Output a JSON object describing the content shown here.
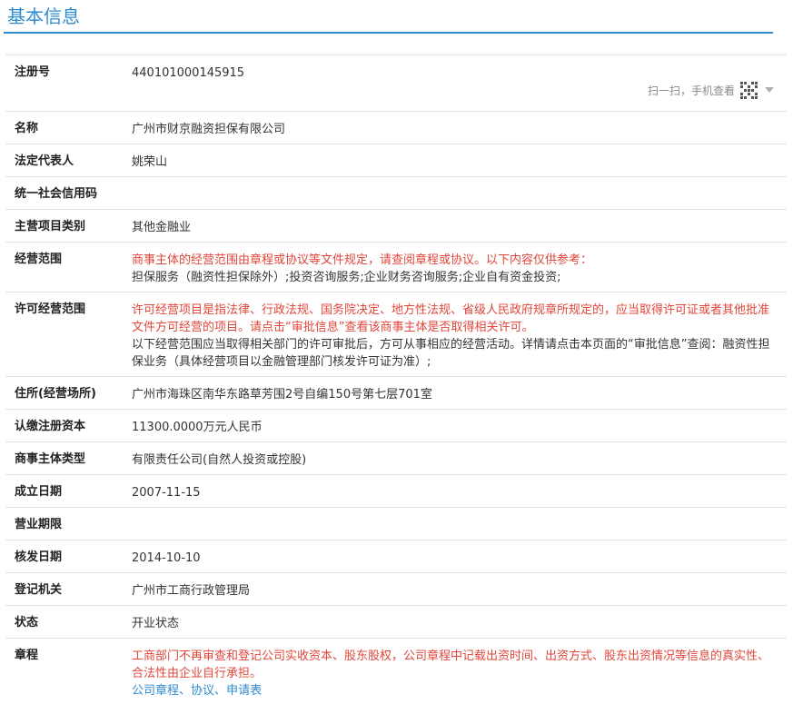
{
  "header": {
    "title": "基本信息"
  },
  "scan": {
    "text": "扫一扫，手机查看"
  },
  "rows": [
    {
      "label": "注册号",
      "value": "440101000145915"
    },
    {
      "label": "名称",
      "value": "广州市财京融资担保有限公司"
    },
    {
      "label": "法定代表人",
      "value": "姚荣山"
    },
    {
      "label": "统一社会信用码",
      "value": ""
    },
    {
      "label": "主营项目类别",
      "value": "其他金融业"
    },
    {
      "label": "经营范围",
      "notice": "商事主体的经营范围由章程或协议等文件规定，请查阅章程或协议。以下内容仅供参考：",
      "value": "担保服务（融资性担保除外）;投资咨询服务;企业财务咨询服务;企业自有资金投资;"
    },
    {
      "label": "许可经营范围",
      "notice": "许可经营项目是指法律、行政法规、国务院决定、地方性法规、省级人民政府规章所规定的，应当取得许可证或者其他批准文件方可经营的项目。请点击“审批信息”查看该商事主体是否取得相关许可。",
      "value": "以下经营范围应当取得相关部门的许可审批后，方可从事相应的经营活动。详情请点击本页面的“审批信息”查阅：融资性担保业务（具体经营项目以金融管理部门核发许可证为准）;"
    },
    {
      "label": "住所(经营场所)",
      "value": "广州市海珠区南华东路草芳围2号自编150号第七层701室"
    },
    {
      "label": "认缴注册资本",
      "value": "11300.0000万元人民币"
    },
    {
      "label": "商事主体类型",
      "value": "有限责任公司(自然人投资或控股)"
    },
    {
      "label": "成立日期",
      "value": "2007-11-15"
    },
    {
      "label": "营业期限",
      "value": ""
    },
    {
      "label": "核发日期",
      "value": "2014-10-10"
    },
    {
      "label": "登记机关",
      "value": "广州市工商行政管理局"
    },
    {
      "label": "状态",
      "value": "开业状态"
    },
    {
      "label": "章程",
      "notice": "工商部门不再审查和登记公司实收资本、股东股权，公司章程中记载出资时间、出资方式、股东出资情况等信息的真实性、合法性由企业自行承担。",
      "links": [
        "公司章程",
        "协议",
        "申请表"
      ],
      "link_separator": "、"
    }
  ],
  "colors": {
    "accent": "#2e8bd0",
    "notice": "#e0463a",
    "border": "#e3e3e3"
  },
  "icons": {
    "qr": "qr-code-icon",
    "chevron": "chevron-down-icon"
  }
}
